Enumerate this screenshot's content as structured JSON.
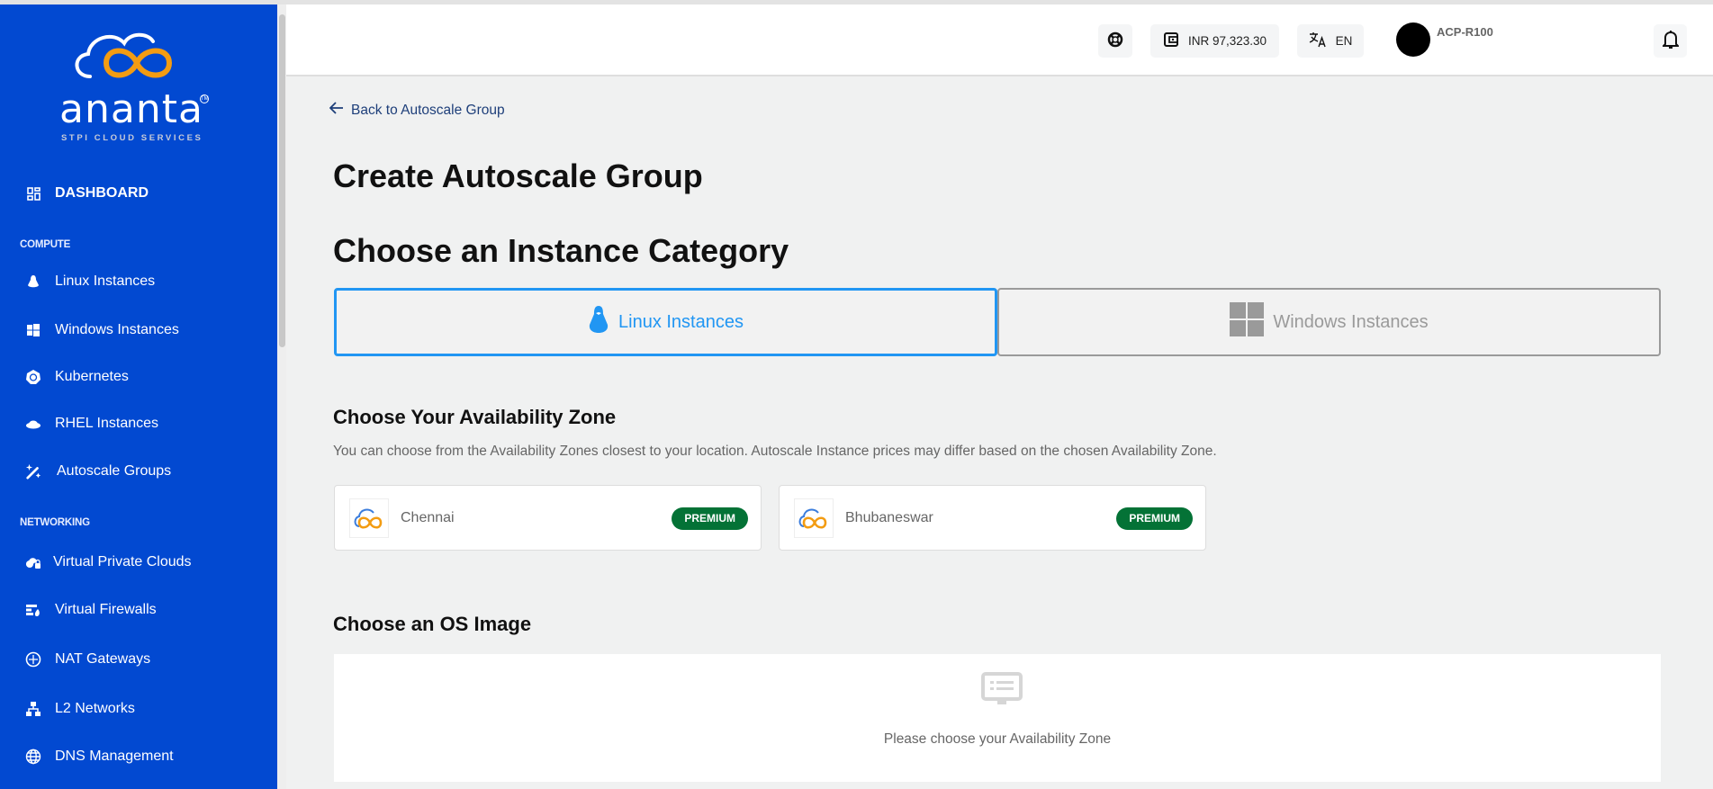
{
  "sidebar": {
    "logo": {
      "word": "ananta",
      "tagline": "STPI CLOUD SERVICES",
      "tm": "TM"
    },
    "dashboard": {
      "label": "DASHBOARD",
      "icon": "dashboard-grid-icon"
    },
    "sections": [
      {
        "title": "COMPUTE",
        "items": [
          {
            "label": "Linux Instances",
            "icon": "linux-penguin-icon"
          },
          {
            "label": "Windows Instances",
            "icon": "windows-logo-icon"
          },
          {
            "label": "Kubernetes",
            "icon": "kubernetes-icon"
          },
          {
            "label": "RHEL Instances",
            "icon": "redhat-hat-icon"
          },
          {
            "label": "Autoscale Groups",
            "icon": "magic-wand-icon"
          }
        ]
      },
      {
        "title": "NETWORKING",
        "items": [
          {
            "label": "Virtual Private Clouds",
            "icon": "cloud-lock-icon"
          },
          {
            "label": "Virtual Firewalls",
            "icon": "firewall-icon"
          },
          {
            "label": "NAT Gateways",
            "icon": "router-icon"
          },
          {
            "label": "L2 Networks",
            "icon": "network-tree-icon"
          },
          {
            "label": "DNS Management",
            "icon": "globe-icon"
          }
        ]
      }
    ]
  },
  "header": {
    "support_icon": "lifebuoy-icon",
    "wallet": {
      "icon": "wallet-icon",
      "balance": "INR 97,323.30"
    },
    "language": {
      "icon": "translate-icon",
      "code": "EN"
    },
    "user": {
      "name": "ACP-R100"
    },
    "notifications_icon": "bell-icon"
  },
  "main": {
    "back_link": "Back to Autoscale Group",
    "page_title": "Create Autoscale Group",
    "category_heading": "Choose an Instance Category",
    "categories": [
      {
        "label": "Linux Instances",
        "selected": true,
        "color": "#2196f3"
      },
      {
        "label": "Windows Instances",
        "selected": false,
        "color": "#9a9a9a"
      }
    ],
    "zone_heading": "Choose Your Availability Zone",
    "zone_description": "You can choose from the Availability Zones closest to your location. Autoscale Instance prices may differ based on the chosen Availability Zone.",
    "zones": [
      {
        "name": "Chennai",
        "badge": "PREMIUM"
      },
      {
        "name": "Bhubaneswar",
        "badge": "PREMIUM"
      }
    ],
    "os_heading": "Choose an OS Image",
    "os_empty_message": "Please choose your Availability Zone"
  },
  "colors": {
    "sidebar_bg": "#0249d1",
    "accent": "#2196f3",
    "premium_badge": "#047236"
  }
}
